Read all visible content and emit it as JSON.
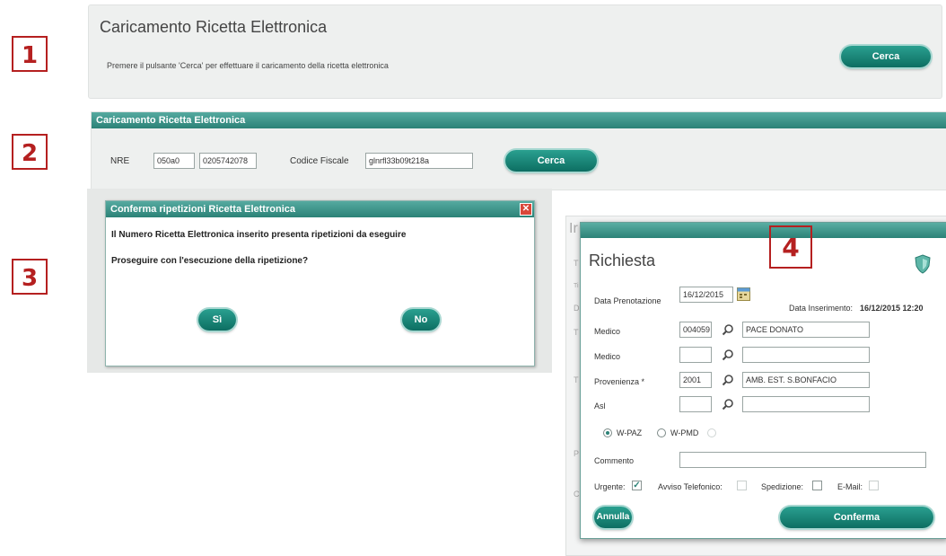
{
  "steps": [
    "1",
    "2",
    "3",
    "4"
  ],
  "panel1": {
    "title": "Caricamento Ricetta Elettronica",
    "description": "Premere il pulsante 'Cerca' per effettuare il caricamento della ricetta elettronica",
    "cerca_label": "Cerca"
  },
  "panel2": {
    "header": "Caricamento Ricetta Elettronica",
    "nre_label": "NRE",
    "nre_part1": "050a0",
    "nre_part2": "0205742078",
    "cf_label": "Codice Fiscale",
    "cf_value": "glnrfl33b09t218a",
    "cerca_label": "Cerca"
  },
  "dialog": {
    "title": "Conferma ripetizioni Ricetta Elettronica",
    "message1": "Il Numero Ricetta Elettronica inserito presenta ripetizioni da eseguire",
    "message2": "Proseguire con l'esecuzione della ripetizione?",
    "yes_label": "Sì",
    "no_label": "No"
  },
  "richiesta": {
    "title": "Richiesta",
    "data_prenotazione_label": "Data Prenotazione",
    "data_prenotazione_value": "16/12/2015",
    "data_inserimento_label": "Data Inserimento:",
    "data_inserimento_value": "16/12/2015 12:20",
    "medico1_label": "Medico",
    "medico1_code": "004059",
    "medico1_name": "PACE DONATO",
    "medico2_label": "Medico",
    "medico2_code": "",
    "medico2_name": "",
    "provenienza_label": "Provenienza *",
    "provenienza_code": "2001",
    "provenienza_name": "AMB. EST. S.BONFACIO",
    "asl_label": "Asl",
    "asl_code": "",
    "asl_name": "",
    "radio_wpaz": "W-PAZ",
    "radio_wpmd": "W-PMD",
    "commento_label": "Commento",
    "commento_value": "",
    "urgente_label": "Urgente:",
    "avviso_label": "Avviso Telefonico:",
    "spedizione_label": "Spedizione:",
    "email_label": "E-Mail:",
    "annulla_label": "Annulla",
    "conferma_label": "Conferma"
  },
  "background_letters": [
    "Ir",
    "T",
    "Ti",
    "D",
    "T",
    "T",
    "P",
    "C"
  ],
  "colors": {
    "teal": "#2c8277",
    "step_red": "#b52020"
  }
}
